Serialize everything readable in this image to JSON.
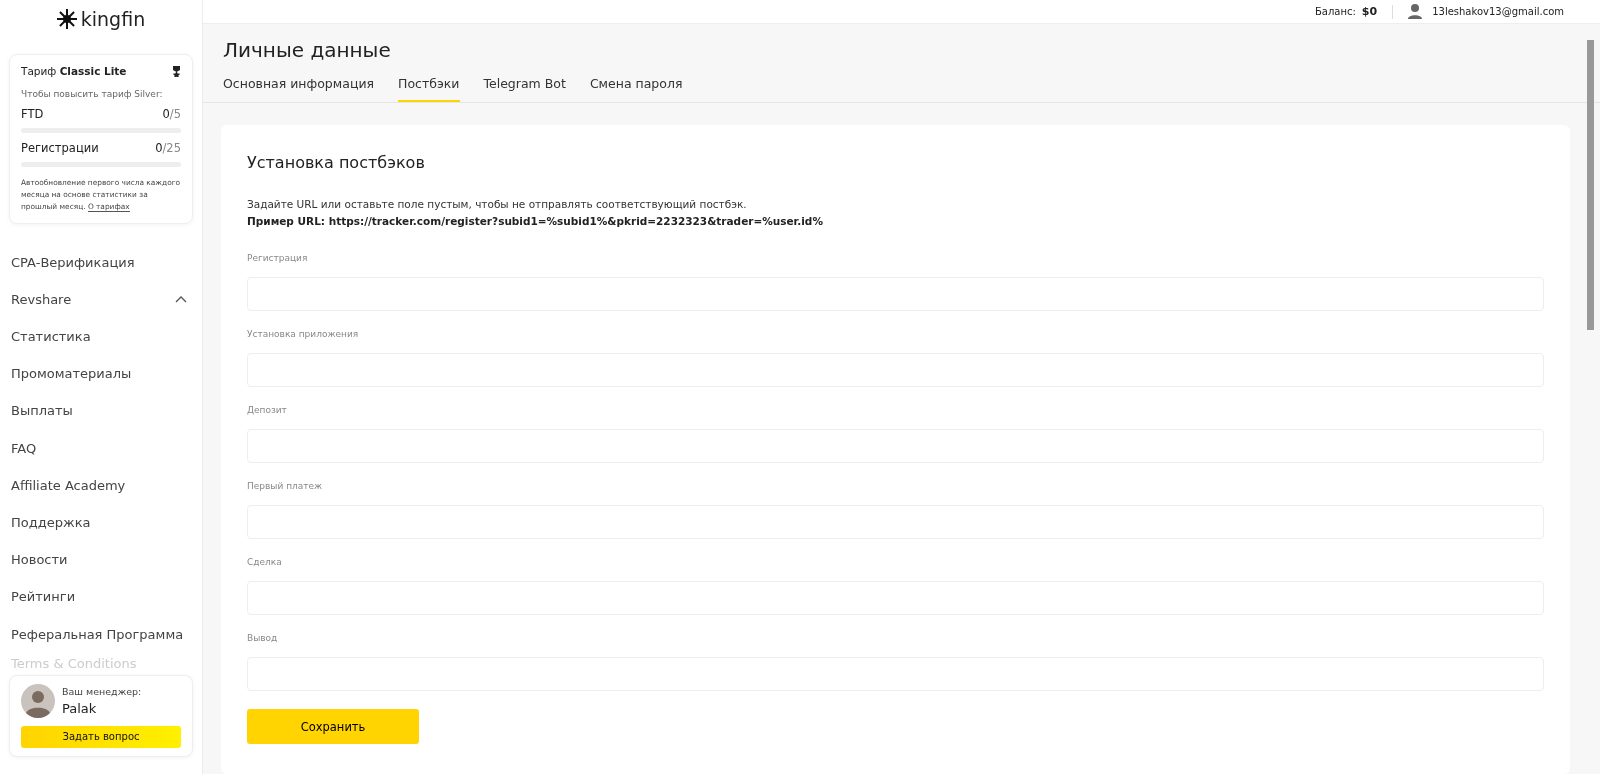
{
  "logo": {
    "text": "kingfin"
  },
  "tariff": {
    "label": "Тариф",
    "name": "Classic Lite",
    "upgrade": "Чтобы повысить тариф Silver:",
    "metrics": [
      {
        "name": "FTD",
        "current": "0",
        "total": "/5",
        "level": 0
      },
      {
        "name": "Регистрации",
        "current": "0",
        "total": "/25",
        "level": 0
      }
    ],
    "note": "Автообновление первого числа каждого месяца на основе статистики за прошлый месяц.",
    "link": "О тарифах"
  },
  "sidebar": {
    "items": [
      {
        "label": "CPA-Верификация",
        "expandable": false
      },
      {
        "label": "Revshare",
        "expandable": true
      },
      {
        "label": "Статистика",
        "expandable": false
      },
      {
        "label": "Промоматериалы",
        "expandable": false
      },
      {
        "label": "Выплаты",
        "expandable": false
      },
      {
        "label": "FAQ",
        "expandable": false
      },
      {
        "label": "Affiliate Academy",
        "expandable": false
      },
      {
        "label": "Поддержка",
        "expandable": false
      },
      {
        "label": "Новости",
        "expandable": false
      },
      {
        "label": "Рейтинги",
        "expandable": false
      },
      {
        "label": "Реферальная Программа",
        "expandable": false
      },
      {
        "label": "Terms & Conditions",
        "expandable": false
      }
    ]
  },
  "manager": {
    "label": "Ваш менеджер:",
    "name": "Palak",
    "button": "Задать вопрос"
  },
  "header": {
    "balance_label": "Баланс:",
    "balance": "$0",
    "email": "13leshakov13@gmail.com"
  },
  "page": {
    "title": "Личные данные",
    "tabs": [
      {
        "label": "Основная информация",
        "selected": false
      },
      {
        "label": "Постбэки",
        "selected": true
      },
      {
        "label": "Telegram Bot",
        "selected": false
      },
      {
        "label": "Смена пароля",
        "selected": false
      }
    ]
  },
  "form": {
    "title": "Установка постбэков",
    "hint": "Задайте URL или оставьте поле пустым, чтобы не отправлять соответствующий постбэк.",
    "example": "Пример URL: https://tracker.com/register?subid1=%subid1%&pkrid=2232323&trader=%user.id%",
    "fields": [
      {
        "label": "Регистрация"
      },
      {
        "label": "Установка приложения"
      },
      {
        "label": "Депозит"
      },
      {
        "label": "Первый платеж"
      },
      {
        "label": "Сделка"
      },
      {
        "label": "Вывод"
      }
    ],
    "button": "Сохранить"
  }
}
